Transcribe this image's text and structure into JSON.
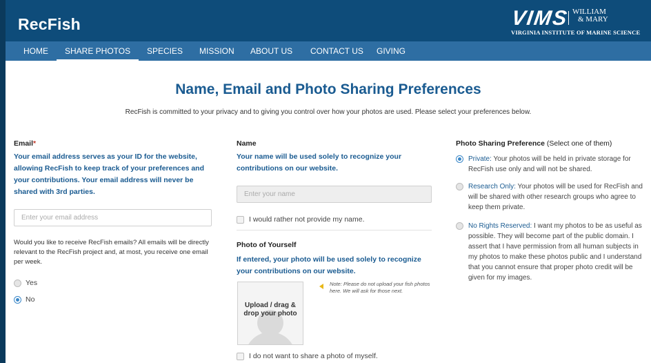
{
  "header": {
    "brand": "RecFish",
    "logo": {
      "vims": "VIMS",
      "william": "WILLIAM",
      "mary": "& MARY",
      "institute": "VIRGINIA INSTITUTE OF MARINE SCIENCE"
    }
  },
  "nav": {
    "items": [
      {
        "label": "HOME"
      },
      {
        "label": "SHARE PHOTOS"
      },
      {
        "label": "SPECIES"
      },
      {
        "label": "MISSION"
      },
      {
        "label": "ABOUT US"
      },
      {
        "label": "CONTACT US"
      },
      {
        "label": "GIVING"
      }
    ],
    "active": "SHARE PHOTOS"
  },
  "page": {
    "title": "Name, Email and Photo Sharing Preferences",
    "intro": "RecFish is committed to your privacy and to giving you control over how your photos are used. Please select your preferences below."
  },
  "email": {
    "label": "Email",
    "required_mark": "*",
    "description": "Your email address serves as your ID for the website, allowing RecFish to keep track of your preferences and your contributions. Your email address will never be shared with 3rd parties.",
    "placeholder": "Enter your email address",
    "value": "",
    "newsletter_question": "Would you like to receive RecFish emails? All emails will be directly relevant to the RecFish project and, at most, you receive one email per week.",
    "options": [
      {
        "label": "Yes",
        "selected": false
      },
      {
        "label": "No",
        "selected": true
      }
    ]
  },
  "name": {
    "label": "Name",
    "description": "Your name will be used solely to recognize your contributions on our website.",
    "placeholder": "Enter your name",
    "value": "",
    "opt_out_label": "I would rather not provide my name.",
    "opt_out_checked": false
  },
  "photo": {
    "label": "Photo of Yourself",
    "description": "If entered, your photo will be used solely to recognize your contributions on our website.",
    "upload_label": "Upload / drag & drop your photo",
    "note": "Note: Please do not upload your fish photos here. We will ask for those next.",
    "opt_out_label": "I do not want to share a photo of myself.",
    "opt_out_checked": false
  },
  "sharing": {
    "label": "Photo Sharing Preference",
    "label_hint": "(Select one of them)",
    "options": [
      {
        "title": "Private:",
        "text": "Your photos will be held in private storage for RecFish use only and will not be shared.",
        "selected": true
      },
      {
        "title": "Research Only:",
        "text": "Your photos will be used for RecFish and will be shared with other research groups who agree to keep them private.",
        "selected": false
      },
      {
        "title": "No Rights Reserved:",
        "text": "I want my photos to be as useful as possible. They will become part of the public domain. I assert that I have permission from all human subjects in my photos to make these photos public and I understand that you cannot ensure that proper photo credit will be given for my images.",
        "selected": false
      }
    ]
  },
  "colors": {
    "header_bg": "#0e4c7a",
    "nav_bg": "#2e6ea3",
    "accent_blue": "#1a5b91",
    "radio_selected": "#3a87c8",
    "required_red": "#c0392b"
  }
}
